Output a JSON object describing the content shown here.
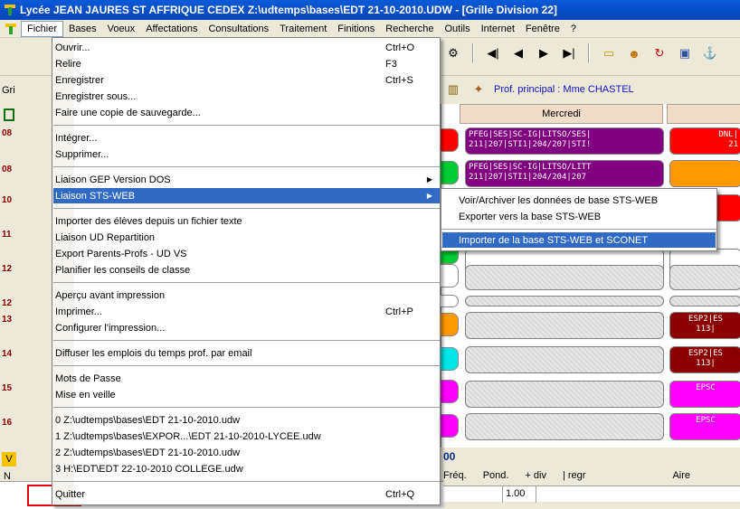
{
  "window": {
    "title": "Lycée JEAN JAURES  ST AFFRIQUE CEDEX   Z:\\udtemps\\bases\\EDT 21-10-2010.UDW - [Grille Division  22]"
  },
  "menubar": [
    "Fichier",
    "Bases",
    "Voeux",
    "Affectations",
    "Consultations",
    "Traitement",
    "Finitions",
    "Recherche",
    "Outils",
    "Internet",
    "Fenêtre",
    "?"
  ],
  "toolbar": {
    "prof_principal": "Prof. principal : Mme CHASTEL",
    "first": "◀|",
    "prev": "◀",
    "next": "▶",
    "last": "▶|"
  },
  "left": {
    "gri_label": "Gri",
    "hours": [
      "08",
      "08",
      "10",
      "11",
      "12",
      "12",
      "13",
      "14",
      "15",
      "16"
    ],
    "v_label": "V",
    "n_label": "N"
  },
  "grid": {
    "day": "Mercredi",
    "cells": [
      {
        "text": "PFEG|SES|SC-IG|LITSO/SES|\n211|207|STI1|204/207|STI!"
      },
      {
        "text": "PFEG|SES|SC-IG|LITSO/LITT\n211|207|STI1|204/204|207"
      },
      {
        "text": "DNL|\n21"
      },
      {
        "text": "ESP2|ES\n113|"
      },
      {
        "text": "ESP2|ES\n113|"
      },
      {
        "text": "EPSC\n"
      },
      {
        "text": "EPSC\n"
      }
    ]
  },
  "fichier_menu": {
    "items": [
      {
        "label": "Ouvrir...",
        "shortcut": "Ctrl+O"
      },
      {
        "label": "Relire",
        "shortcut": "F3"
      },
      {
        "label": "Enregistrer",
        "shortcut": "Ctrl+S"
      },
      {
        "label": "Enregistrer sous...",
        "shortcut": ""
      },
      {
        "label": "Faire une copie de sauvegarde...",
        "shortcut": ""
      },
      {
        "label": "Intégrer...",
        "shortcut": ""
      },
      {
        "label": "Supprimer...",
        "shortcut": ""
      },
      {
        "label": "Liaison GEP Version DOS",
        "shortcut": ""
      },
      {
        "label": "Liaison STS-WEB",
        "shortcut": ""
      },
      {
        "label": "Importer des élèves depuis un fichier texte",
        "shortcut": ""
      },
      {
        "label": "Liaison UD Repartition",
        "shortcut": ""
      },
      {
        "label": "Export Parents-Profs - UD VS",
        "shortcut": ""
      },
      {
        "label": "Planifier les conseils de classe",
        "shortcut": ""
      },
      {
        "label": "Aperçu avant impression",
        "shortcut": ""
      },
      {
        "label": "Imprimer...",
        "shortcut": "Ctrl+P"
      },
      {
        "label": "Configurer l'impression...",
        "shortcut": ""
      },
      {
        "label": "Diffuser les emplois du temps prof. par email",
        "shortcut": ""
      },
      {
        "label": "Mots de Passe",
        "shortcut": ""
      },
      {
        "label": "Mise en veille",
        "shortcut": ""
      },
      {
        "label": "0 Z:\\udtemps\\bases\\EDT 21-10-2010.udw",
        "shortcut": ""
      },
      {
        "label": "1 Z:\\udtemps\\bases\\EXPOR...\\EDT 21-10-2010-LYCEE.udw",
        "shortcut": ""
      },
      {
        "label": "2 Z:\\udtemps\\bases\\EDT 21-10-2010.udw",
        "shortcut": ""
      },
      {
        "label": "3 H:\\EDT\\EDT 22-10-2010 COLLEGE.udw",
        "shortcut": ""
      },
      {
        "label": "Quitter",
        "shortcut": "Ctrl+Q"
      }
    ]
  },
  "sts_submenu": {
    "items": [
      {
        "label": "Voir/Archiver les  données de base STS-WEB"
      },
      {
        "label": "Exporter vers la base STS-WEB"
      },
      {
        "label": "Importer de la base STS-WEB et SCONET"
      }
    ]
  },
  "bottom": {
    "title": "00",
    "headers": [
      "Fréq.",
      "Pond.",
      "+ div",
      "| regr",
      "Aire"
    ],
    "pond_value": "1.00"
  }
}
